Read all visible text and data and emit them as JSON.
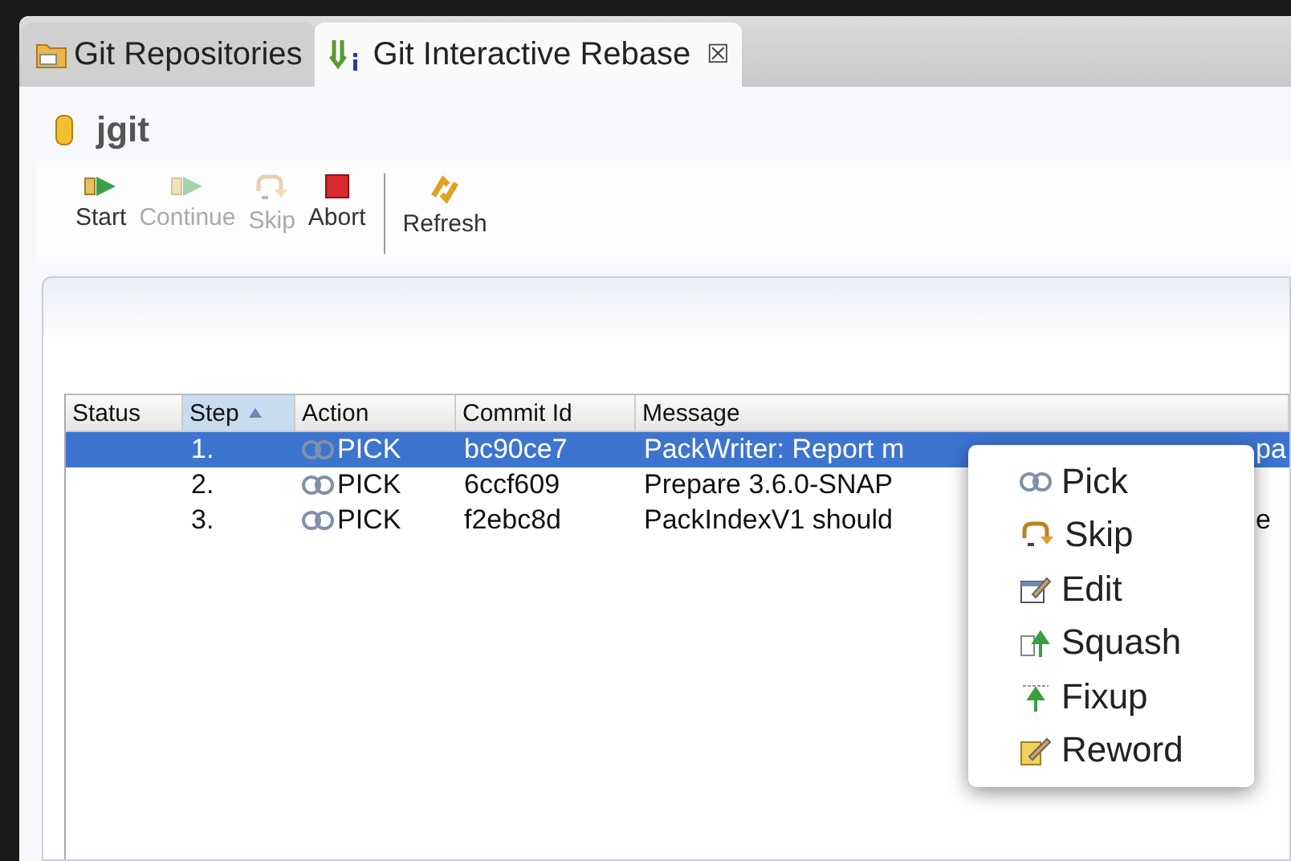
{
  "tabs": [
    {
      "label": "Git Repositories",
      "selected": false,
      "kind": "repos"
    },
    {
      "label": "Git Interactive Rebase",
      "selected": true,
      "kind": "rebase",
      "close": "☒"
    }
  ],
  "header": {
    "title": "jgit"
  },
  "toolbar": [
    {
      "label": "Start",
      "kind": "start",
      "disabled": false
    },
    {
      "label": "Continue",
      "kind": "continue",
      "disabled": true
    },
    {
      "label": "Skip",
      "kind": "skip",
      "disabled": true
    },
    {
      "label": "Abort",
      "kind": "abort",
      "disabled": false
    },
    {
      "label": "Refresh",
      "kind": "refresh",
      "disabled": false,
      "separator_before": true
    }
  ],
  "table": {
    "columns": [
      {
        "label": "Status",
        "sorted": false
      },
      {
        "label": "Step",
        "sorted": true
      },
      {
        "label": "Action",
        "sorted": false
      },
      {
        "label": "Commit Id",
        "sorted": false
      },
      {
        "label": "Message",
        "sorted": false
      }
    ],
    "rows": [
      {
        "step": "1.",
        "action": "PICK",
        "commit": "bc90ce7",
        "message": "PackWriter: Report m",
        "message_tail": "pa",
        "selected": true
      },
      {
        "step": "2.",
        "action": "PICK",
        "commit": "6ccf609",
        "message": "Prepare 3.6.0-SNAP",
        "message_tail": "",
        "selected": false
      },
      {
        "step": "3.",
        "action": "PICK",
        "commit": "f2ebc8d",
        "message": "PackIndexV1 should",
        "message_tail": "e",
        "selected": false
      }
    ]
  },
  "context_menu": [
    {
      "label": "Pick",
      "kind": "pick"
    },
    {
      "label": "Skip",
      "kind": "skip"
    },
    {
      "label": "Edit",
      "kind": "edit"
    },
    {
      "label": "Squash",
      "kind": "squash"
    },
    {
      "label": "Fixup",
      "kind": "fixup"
    },
    {
      "label": "Reword",
      "kind": "reword"
    }
  ]
}
